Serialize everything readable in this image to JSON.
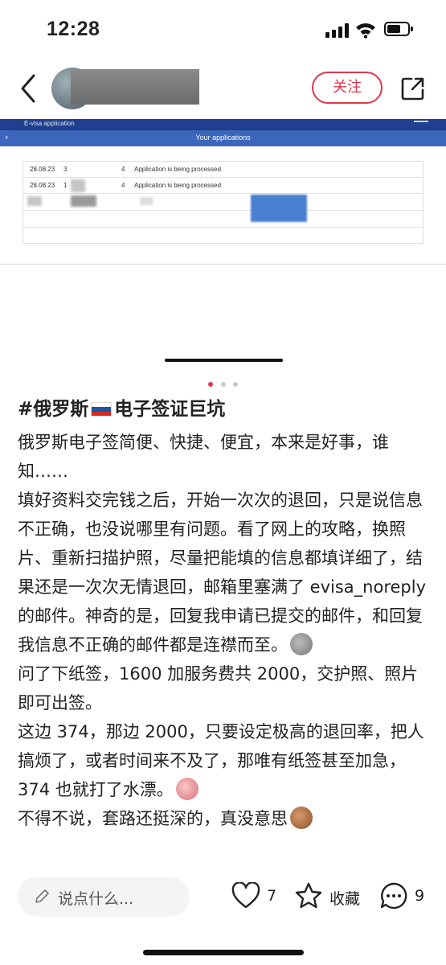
{
  "status_bar": {
    "time": "12:28"
  },
  "header": {
    "follow_label": "关注"
  },
  "screenshot": {
    "app_label": "E-visa application",
    "page_title": "Your applications",
    "rows": [
      {
        "date": "28.08.23",
        "code": "3",
        "num": "4",
        "status": "Application is being processed"
      },
      {
        "date": "28.08.23",
        "code": "1",
        "num": "4",
        "status": "Application is being processed"
      }
    ]
  },
  "carousel": {
    "count": 3,
    "active": 0
  },
  "post": {
    "title_prefix": "#俄罗斯",
    "title_suffix": "电子签证巨坑",
    "paragraphs": [
      "俄罗斯电子签简便、快捷、便宜，本来是好事，谁知……",
      "填好资料交完钱之后，开始一次次的退回，只是说信息不正确，也没说哪里有问题。看了网上的攻略，换照片、重新扫描护照，尽量把能填的信息都填详细了，结果还是一次次无情退回，邮箱里塞满了 evisa_noreply 的邮件。神奇的是，回复我申请已提交的邮件，和回复我信息不正确的邮件都是连襟而至。",
      "问了下纸签，1600 加服务费共 2000，交护照、照片即可出签。",
      "这边 374，那边 2000，只要设定极高的退回率，把人搞烦了，或者时间来不及了，那唯有纸签甚至加急，374 也就打了水漂。",
      "不得不说，套路还挺深的，真没意思"
    ]
  },
  "bottom_bar": {
    "comment_placeholder": "说点什么...",
    "likes": "7",
    "collect_label": "收藏",
    "comments": "9"
  },
  "colors": {
    "accent": "#e0364f",
    "evisa_dark": "#1f3f8f",
    "evisa_blue": "#3c66bc"
  }
}
